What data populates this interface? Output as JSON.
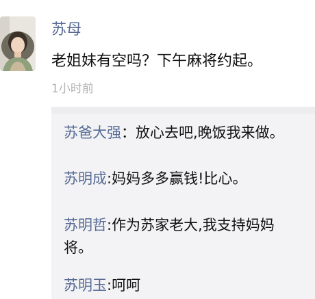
{
  "post": {
    "author": "苏母",
    "text": "老姐妹有空吗？下午麻将约起。",
    "timestamp": "1小时前",
    "avatar_icon": "profile-photo-icon"
  },
  "comments": [
    {
      "name": "苏爸大强",
      "separator": "：",
      "text": "放心去吧,晚饭我来做。"
    },
    {
      "name": "苏明成",
      "separator": ":",
      "text": "妈妈多多赢钱!比心。"
    },
    {
      "name": "苏明哲",
      "separator": ":",
      "text": "作为苏家老大,我支持妈妈",
      "continuation": "将。"
    },
    {
      "name": "苏明玉",
      "separator": ":",
      "text": "呵呵"
    }
  ],
  "colors": {
    "name_link": "#576b95",
    "comment_bg": "#f3f3f5",
    "timestamp": "#b2b2b2",
    "text": "#111111"
  }
}
